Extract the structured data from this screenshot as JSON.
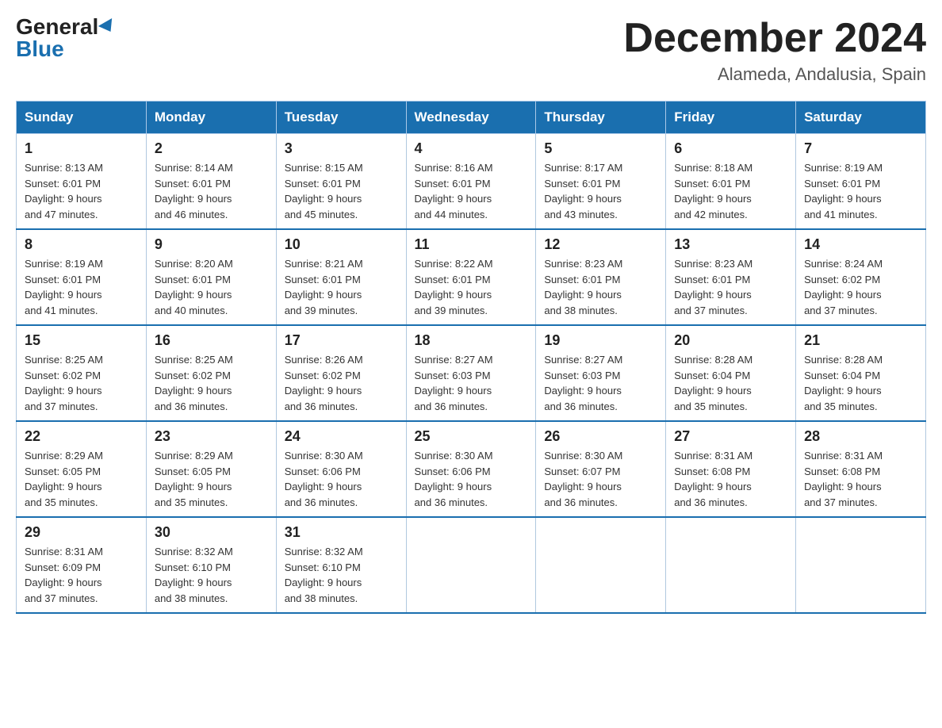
{
  "logo": {
    "general": "General",
    "blue": "Blue"
  },
  "title": "December 2024",
  "location": "Alameda, Andalusia, Spain",
  "days_of_week": [
    "Sunday",
    "Monday",
    "Tuesday",
    "Wednesday",
    "Thursday",
    "Friday",
    "Saturday"
  ],
  "weeks": [
    [
      {
        "day": "1",
        "sunrise": "8:13 AM",
        "sunset": "6:01 PM",
        "daylight": "9 hours and 47 minutes."
      },
      {
        "day": "2",
        "sunrise": "8:14 AM",
        "sunset": "6:01 PM",
        "daylight": "9 hours and 46 minutes."
      },
      {
        "day": "3",
        "sunrise": "8:15 AM",
        "sunset": "6:01 PM",
        "daylight": "9 hours and 45 minutes."
      },
      {
        "day": "4",
        "sunrise": "8:16 AM",
        "sunset": "6:01 PM",
        "daylight": "9 hours and 44 minutes."
      },
      {
        "day": "5",
        "sunrise": "8:17 AM",
        "sunset": "6:01 PM",
        "daylight": "9 hours and 43 minutes."
      },
      {
        "day": "6",
        "sunrise": "8:18 AM",
        "sunset": "6:01 PM",
        "daylight": "9 hours and 42 minutes."
      },
      {
        "day": "7",
        "sunrise": "8:19 AM",
        "sunset": "6:01 PM",
        "daylight": "9 hours and 41 minutes."
      }
    ],
    [
      {
        "day": "8",
        "sunrise": "8:19 AM",
        "sunset": "6:01 PM",
        "daylight": "9 hours and 41 minutes."
      },
      {
        "day": "9",
        "sunrise": "8:20 AM",
        "sunset": "6:01 PM",
        "daylight": "9 hours and 40 minutes."
      },
      {
        "day": "10",
        "sunrise": "8:21 AM",
        "sunset": "6:01 PM",
        "daylight": "9 hours and 39 minutes."
      },
      {
        "day": "11",
        "sunrise": "8:22 AM",
        "sunset": "6:01 PM",
        "daylight": "9 hours and 39 minutes."
      },
      {
        "day": "12",
        "sunrise": "8:23 AM",
        "sunset": "6:01 PM",
        "daylight": "9 hours and 38 minutes."
      },
      {
        "day": "13",
        "sunrise": "8:23 AM",
        "sunset": "6:01 PM",
        "daylight": "9 hours and 37 minutes."
      },
      {
        "day": "14",
        "sunrise": "8:24 AM",
        "sunset": "6:02 PM",
        "daylight": "9 hours and 37 minutes."
      }
    ],
    [
      {
        "day": "15",
        "sunrise": "8:25 AM",
        "sunset": "6:02 PM",
        "daylight": "9 hours and 37 minutes."
      },
      {
        "day": "16",
        "sunrise": "8:25 AM",
        "sunset": "6:02 PM",
        "daylight": "9 hours and 36 minutes."
      },
      {
        "day": "17",
        "sunrise": "8:26 AM",
        "sunset": "6:02 PM",
        "daylight": "9 hours and 36 minutes."
      },
      {
        "day": "18",
        "sunrise": "8:27 AM",
        "sunset": "6:03 PM",
        "daylight": "9 hours and 36 minutes."
      },
      {
        "day": "19",
        "sunrise": "8:27 AM",
        "sunset": "6:03 PM",
        "daylight": "9 hours and 36 minutes."
      },
      {
        "day": "20",
        "sunrise": "8:28 AM",
        "sunset": "6:04 PM",
        "daylight": "9 hours and 35 minutes."
      },
      {
        "day": "21",
        "sunrise": "8:28 AM",
        "sunset": "6:04 PM",
        "daylight": "9 hours and 35 minutes."
      }
    ],
    [
      {
        "day": "22",
        "sunrise": "8:29 AM",
        "sunset": "6:05 PM",
        "daylight": "9 hours and 35 minutes."
      },
      {
        "day": "23",
        "sunrise": "8:29 AM",
        "sunset": "6:05 PM",
        "daylight": "9 hours and 35 minutes."
      },
      {
        "day": "24",
        "sunrise": "8:30 AM",
        "sunset": "6:06 PM",
        "daylight": "9 hours and 36 minutes."
      },
      {
        "day": "25",
        "sunrise": "8:30 AM",
        "sunset": "6:06 PM",
        "daylight": "9 hours and 36 minutes."
      },
      {
        "day": "26",
        "sunrise": "8:30 AM",
        "sunset": "6:07 PM",
        "daylight": "9 hours and 36 minutes."
      },
      {
        "day": "27",
        "sunrise": "8:31 AM",
        "sunset": "6:08 PM",
        "daylight": "9 hours and 36 minutes."
      },
      {
        "day": "28",
        "sunrise": "8:31 AM",
        "sunset": "6:08 PM",
        "daylight": "9 hours and 37 minutes."
      }
    ],
    [
      {
        "day": "29",
        "sunrise": "8:31 AM",
        "sunset": "6:09 PM",
        "daylight": "9 hours and 37 minutes."
      },
      {
        "day": "30",
        "sunrise": "8:32 AM",
        "sunset": "6:10 PM",
        "daylight": "9 hours and 38 minutes."
      },
      {
        "day": "31",
        "sunrise": "8:32 AM",
        "sunset": "6:10 PM",
        "daylight": "9 hours and 38 minutes."
      },
      null,
      null,
      null,
      null
    ]
  ],
  "labels": {
    "sunrise": "Sunrise:",
    "sunset": "Sunset:",
    "daylight": "Daylight:"
  }
}
